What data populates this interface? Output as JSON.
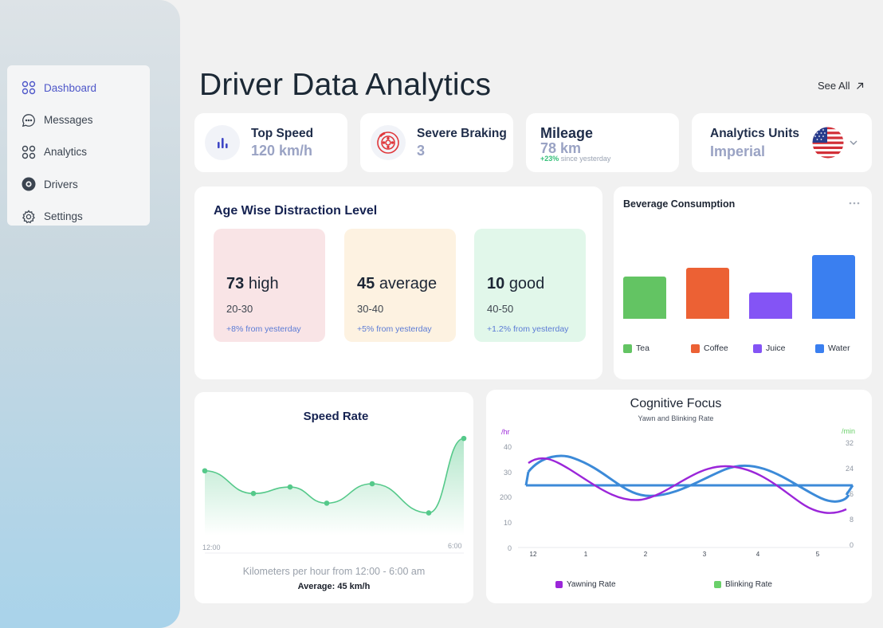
{
  "nav": {
    "items": [
      {
        "label": "Dashboard",
        "icon": "dashboard-icon",
        "active": true
      },
      {
        "label": "Messages",
        "icon": "message-icon",
        "active": false
      },
      {
        "label": "Analytics",
        "icon": "analytics-icon",
        "active": false
      },
      {
        "label": "Drivers",
        "icon": "driver-icon",
        "active": false
      },
      {
        "label": "Settings",
        "icon": "gear-icon",
        "active": false
      }
    ]
  },
  "header": {
    "title": "Driver Data Analytics",
    "see_all": "See All"
  },
  "stats": {
    "top_speed": {
      "label": "Top Speed",
      "value": "120 km/h",
      "icon": "bar-chart-icon"
    },
    "severe_braking": {
      "label": "Severe Braking",
      "value": "3",
      "icon": "brake-disc-icon"
    },
    "mileage": {
      "label": "Mileage",
      "value": "78 km",
      "delta": "+23%",
      "delta_note": "since yesterday"
    },
    "units": {
      "label": "Analytics Units",
      "value": "Imperial",
      "icon": "us-flag-icon"
    }
  },
  "distraction": {
    "title": "Age Wise Distraction Level",
    "levels": [
      {
        "count": "73",
        "level": "high",
        "range": "20-30",
        "delta": "+8% from yesterday",
        "color": "#f9e4e6"
      },
      {
        "count": "45",
        "level": "average",
        "range": "30-40",
        "delta": "+5% from yesterday",
        "color": "#fdf2e1"
      },
      {
        "count": "10",
        "level": "good",
        "range": "40-50",
        "delta": "+1.2% from yesterday",
        "color": "#e1f7ea"
      }
    ]
  },
  "beverage": {
    "title": "Beverage Consumption",
    "chart_data": {
      "type": "bar",
      "categories": [
        "Tea",
        "Coffee",
        "Juice",
        "Water"
      ],
      "values": [
        53,
        64,
        33,
        80
      ],
      "colors": [
        "#63c463",
        "#ec6134",
        "#8454f5",
        "#3a7ff0"
      ]
    }
  },
  "speed": {
    "title": "Speed Rate",
    "x_start": "12:00",
    "x_end": "6:00",
    "caption": "Kilometers per hour from 12:00 - 6:00 am",
    "average": "Average: 45 km/h",
    "chart_data": {
      "type": "area",
      "y": [
        50,
        43,
        45,
        40,
        46,
        37,
        60
      ],
      "ylim": [
        30,
        62
      ],
      "color": "#55c98a"
    }
  },
  "cognitive": {
    "title": "Cognitive Focus",
    "subtitle": "Yawn and Blinking Rate",
    "left_unit": "/hr",
    "right_unit": "/min",
    "left_ticks": [
      "40",
      "30",
      "200",
      "10",
      "0"
    ],
    "right_ticks": [
      "32",
      "24",
      "16",
      "8",
      "0"
    ],
    "x_ticks": [
      "12",
      "1",
      "2",
      "3",
      "4",
      "5"
    ],
    "legend": [
      {
        "name": "Yawning Rate",
        "color": "#9b26d9"
      },
      {
        "name": "Blinking Rate",
        "color": "#6ad06a"
      }
    ],
    "chart_data": {
      "type": "line",
      "series": [
        {
          "name": "Yawning Rate",
          "color": "#9b26d9"
        },
        {
          "name": "Blinking Rate",
          "color": "#3c8ad8"
        }
      ]
    }
  }
}
